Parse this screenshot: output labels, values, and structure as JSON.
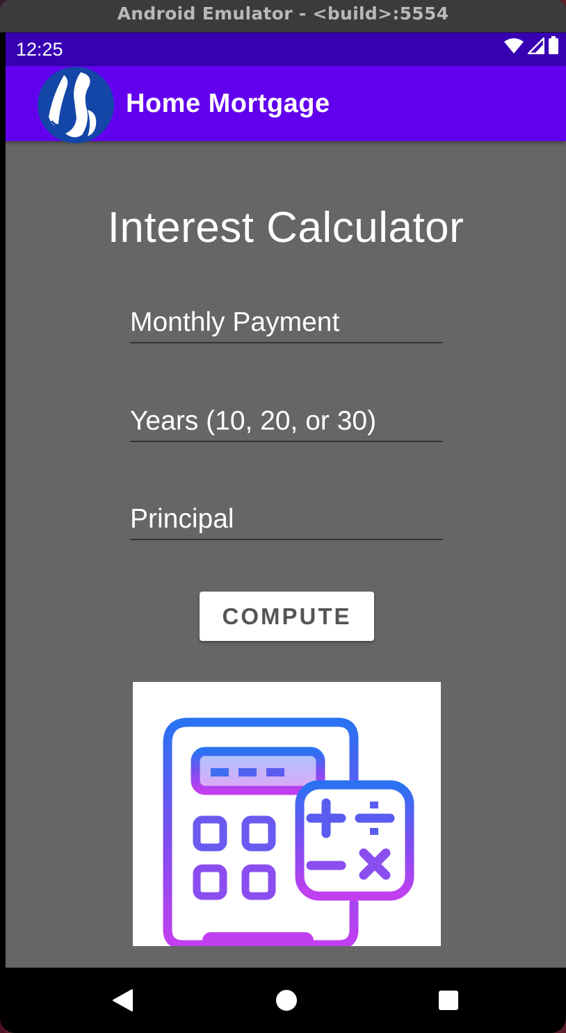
{
  "window": {
    "title": "Android Emulator - <build>:5554"
  },
  "status_bar": {
    "time": "12:25",
    "icons": [
      "wifi-icon",
      "cell-signal-icon",
      "battery-icon"
    ]
  },
  "app_bar": {
    "title": "Home Mortgage",
    "logo": "app-logo-icon",
    "color": "#6200ee",
    "status_color": "#3700b3"
  },
  "main": {
    "heading": "Interest Calculator",
    "fields": {
      "monthly_payment": {
        "value": "",
        "placeholder": "Monthly Payment"
      },
      "years": {
        "value": "",
        "placeholder": "Years (10, 20, or 30)"
      },
      "principal": {
        "value": "",
        "placeholder": "Principal"
      }
    },
    "compute_label": "COMPUTE",
    "image": "calculator-icon"
  },
  "nav_bar": {
    "buttons": [
      "back-icon",
      "home-icon",
      "recents-icon"
    ]
  }
}
